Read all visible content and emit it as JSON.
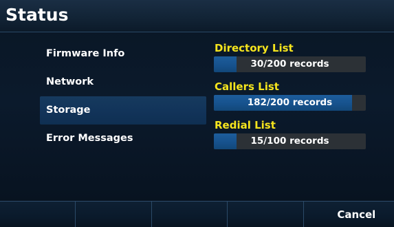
{
  "header": {
    "title": "Status"
  },
  "menu": {
    "items": [
      {
        "label": "Firmware Info",
        "selected": false
      },
      {
        "label": "Network",
        "selected": false
      },
      {
        "label": "Storage",
        "selected": true
      },
      {
        "label": "Error Messages",
        "selected": false
      }
    ]
  },
  "storage": {
    "sections": [
      {
        "label": "Directory List",
        "usage_text": "30/200 records",
        "used": 30,
        "capacity": 200
      },
      {
        "label": "Callers List",
        "usage_text": "182/200 records",
        "used": 182,
        "capacity": 200
      },
      {
        "label": "Redial List",
        "usage_text": "15/100 records",
        "used": 15,
        "capacity": 100
      }
    ]
  },
  "softkeys": [
    "",
    "",
    "",
    "",
    "Cancel"
  ],
  "colors": {
    "section_label": "#f6e51d",
    "bar_fill": "#16518c",
    "bar_track": "#2c3136",
    "selected_item": "#12345a"
  }
}
